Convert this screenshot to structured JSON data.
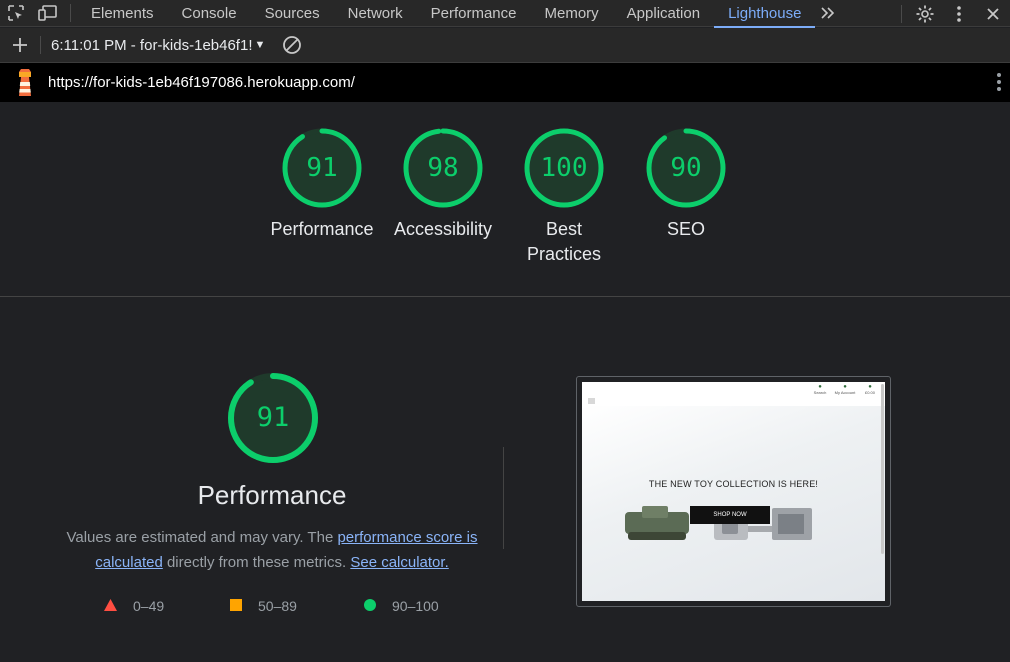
{
  "devtools": {
    "tabs": [
      "Elements",
      "Console",
      "Sources",
      "Network",
      "Performance",
      "Memory",
      "Application",
      "Lighthouse"
    ],
    "active_tab": "Lighthouse"
  },
  "toolbar": {
    "report_label": "6:11:01 PM - for-kids-1eb46f1!"
  },
  "urlbar": {
    "url": "https://for-kids-1eb46f197086.herokuapp.com/"
  },
  "scores": [
    {
      "label": "Performance",
      "value": "91"
    },
    {
      "label": "Accessibility",
      "value": "98"
    },
    {
      "label": "Best Practices",
      "value": "100"
    },
    {
      "label": "SEO",
      "value": "90"
    }
  ],
  "performance": {
    "score": "91",
    "title": "Performance",
    "desc_prefix": "Values are estimated and may vary. The ",
    "desc_link1": "performance score is calculated",
    "desc_middle": " directly from these metrics. ",
    "desc_link2": "See calculator."
  },
  "legend": [
    {
      "range": "0–49",
      "color": "#ff4e42",
      "shape": "triangle"
    },
    {
      "range": "50–89",
      "color": "#ffa400",
      "shape": "square"
    },
    {
      "range": "90–100",
      "color": "#0cce6b",
      "shape": "circle"
    }
  ],
  "thumbnail": {
    "headline": "THE NEW TOY COLLECTION IS HERE!",
    "button": "SHOP NOW",
    "header_items": [
      "Search",
      "My Account",
      "£0.00"
    ]
  }
}
